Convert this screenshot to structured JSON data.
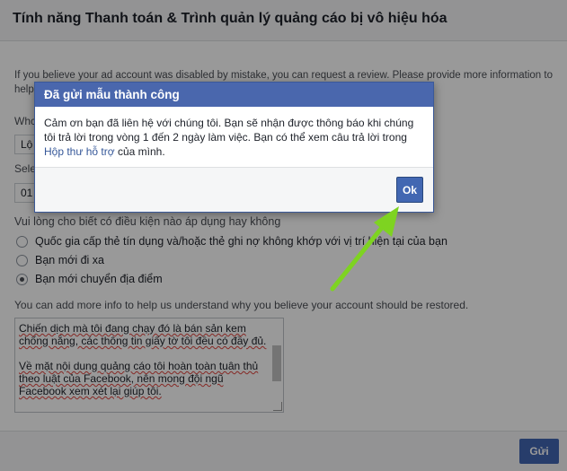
{
  "page": {
    "title": "Tính năng Thanh toán & Trình quản lý quảng cáo bị vô hiệu hóa",
    "intro_text": "If you believe your ad account was disabled by mistake, you can request a review. Please provide more information to help",
    "question1_label": "Whc",
    "select1_value": "Lộ",
    "question2_label": "Sele",
    "select2_value": "01",
    "conditions_label": "Vui lòng cho biết có điều kiện nào áp dụng hay không",
    "options": [
      {
        "label": "Quốc gia cấp thẻ tín dụng và/hoặc thẻ ghi nợ không khớp với vị trí hiện tại của bạn",
        "selected": false
      },
      {
        "label": "Bạn mới đi xa",
        "selected": false
      },
      {
        "label": "Bạn mới chuyển địa điểm",
        "selected": true
      }
    ],
    "more_info_label": "You can add more info to help us understand why you believe your account should be restored.",
    "textarea_paragraphs": [
      "Chiến dịch mà tôi đang chạy đó là bán sản kem chống nắng, các thông tin giấy tờ tôi đều có đầy đủ.",
      "Về mặt nội dung quảng cáo tôi hoàn toàn tuân thủ theo luật của Facebook, nên mong đội ngũ Facebook xem xét lại giúp tôi."
    ],
    "send_button": "Gửi"
  },
  "modal": {
    "title": "Đã gửi mẫu thành công",
    "body_text": "Cảm ơn bạn đã liên hệ với chúng tôi. Bạn sẽ nhận được thông báo khi chúng tôi trả lời trong vòng 1 đến 2 ngày làm việc. Bạn có thể xem câu trả lời trong",
    "link_text": "Hộp thư hỗ trợ",
    "body_suffix": "của mình.",
    "ok_button": "Ok"
  },
  "colors": {
    "accent": "#4267b2",
    "modal_header": "#4a67ad",
    "link": "#365899",
    "arrow": "#7ed321"
  },
  "icons": [
    "radio-icon",
    "pointer-arrow-icon"
  ]
}
